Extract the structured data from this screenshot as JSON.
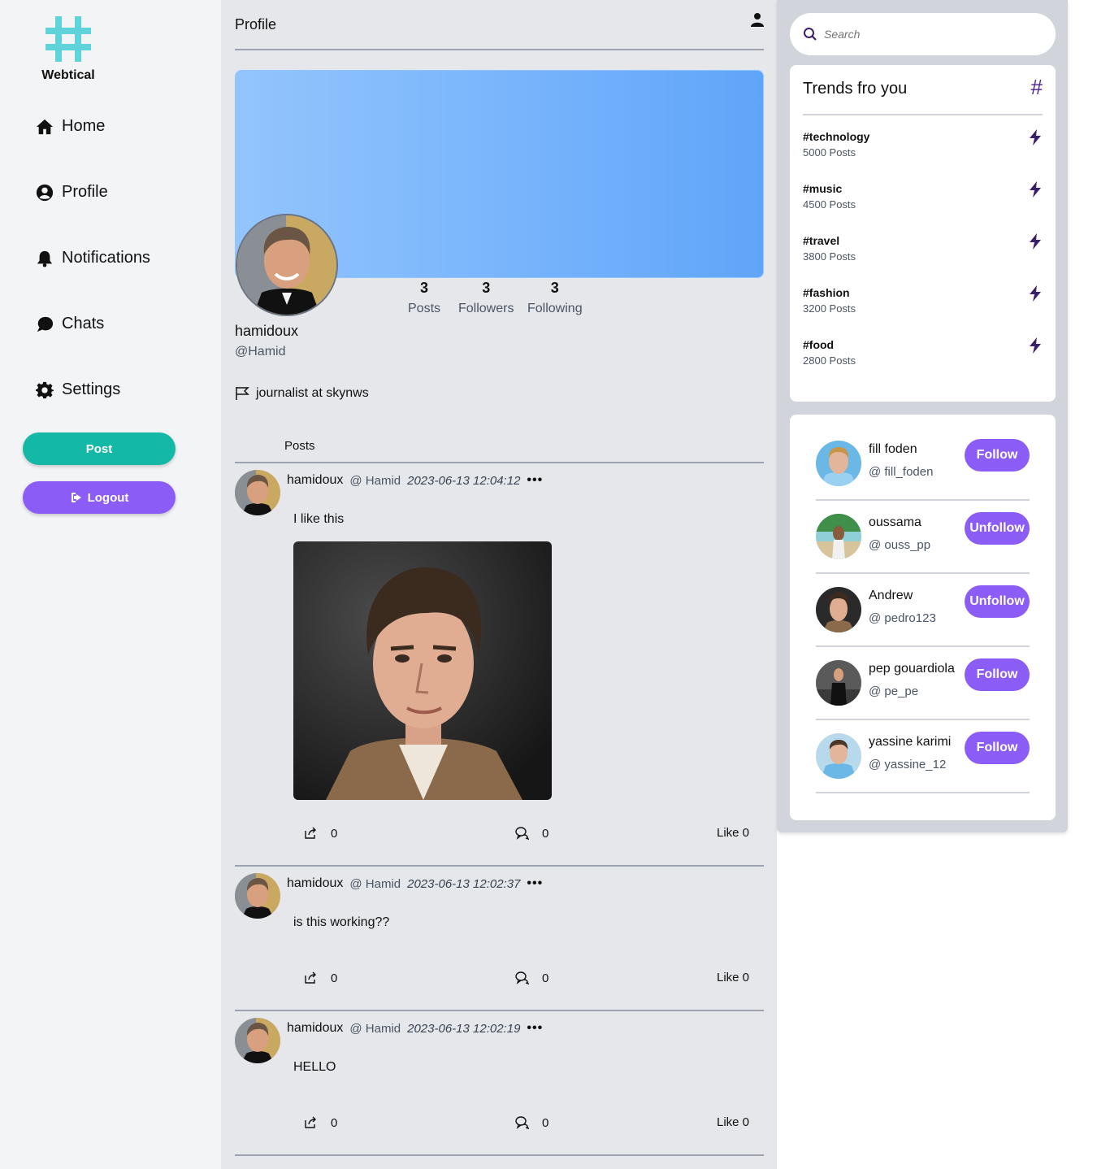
{
  "app": {
    "name": "Webtical"
  },
  "nav": [
    {
      "label": "Home",
      "icon": "home-icon"
    },
    {
      "label": "Profile",
      "icon": "user-circle-icon"
    },
    {
      "label": "Notifications",
      "icon": "bell-icon"
    },
    {
      "label": "Chats",
      "icon": "chat-icon"
    },
    {
      "label": "Settings",
      "icon": "gear-icon"
    }
  ],
  "actions": {
    "post_label": "Post",
    "logout_label": "Logout"
  },
  "header": {
    "title": "Profile"
  },
  "profile": {
    "name": "hamidoux",
    "handle": "@Hamid",
    "bio": "journalist at skynws",
    "stats": [
      {
        "value": "3",
        "label": "Posts"
      },
      {
        "value": "3",
        "label": "Followers"
      },
      {
        "value": "3",
        "label": "Following"
      }
    ]
  },
  "posts_tab": "Posts",
  "posts": [
    {
      "user": "hamidoux",
      "handle": "@ Hamid",
      "date": "2023-06-13 12:04:12",
      "dots": "•••",
      "text": "I like this",
      "has_image": true,
      "shares": "0",
      "comments": "0",
      "like_label": "Like 0"
    },
    {
      "user": "hamidoux",
      "handle": "@ Hamid",
      "date": "2023-06-13 12:02:37",
      "dots": "•••",
      "text": "is this working??",
      "has_image": false,
      "shares": "0",
      "comments": "0",
      "like_label": "Like 0"
    },
    {
      "user": "hamidoux",
      "handle": "@ Hamid",
      "date": "2023-06-13 12:02:19",
      "dots": "•••",
      "text": "HELLO",
      "has_image": false,
      "shares": "0",
      "comments": "0",
      "like_label": "Like 0"
    }
  ],
  "search": {
    "placeholder": "Search"
  },
  "trends": {
    "title": "Trends fro you",
    "hash": "#",
    "items": [
      {
        "tag": "#technology",
        "count": "5000 Posts"
      },
      {
        "tag": "#music",
        "count": "4500 Posts"
      },
      {
        "tag": "#travel",
        "count": "3800 Posts"
      },
      {
        "tag": "#fashion",
        "count": "3200 Posts"
      },
      {
        "tag": "#food",
        "count": "2800 Posts"
      }
    ]
  },
  "suggestions": [
    {
      "name": "fill foden",
      "handle": "@ fill_foden",
      "button": "Follow"
    },
    {
      "name": "oussama",
      "handle": "@ ouss_pp",
      "button": "Unfollow"
    },
    {
      "name": "Andrew",
      "handle": "@ pedro123",
      "button": "Unfollow"
    },
    {
      "name": "pep gouardiola",
      "handle": "@ pe_pe",
      "button": "Follow"
    },
    {
      "name": "yassine karimi",
      "handle": "@ yassine_12",
      "button": "Follow"
    }
  ],
  "colors": {
    "accent_teal": "#14b8a6",
    "accent_purple": "#8b5cf6",
    "logo_cyan": "#5ed3d9",
    "trend_purple": "#4c1d95"
  }
}
